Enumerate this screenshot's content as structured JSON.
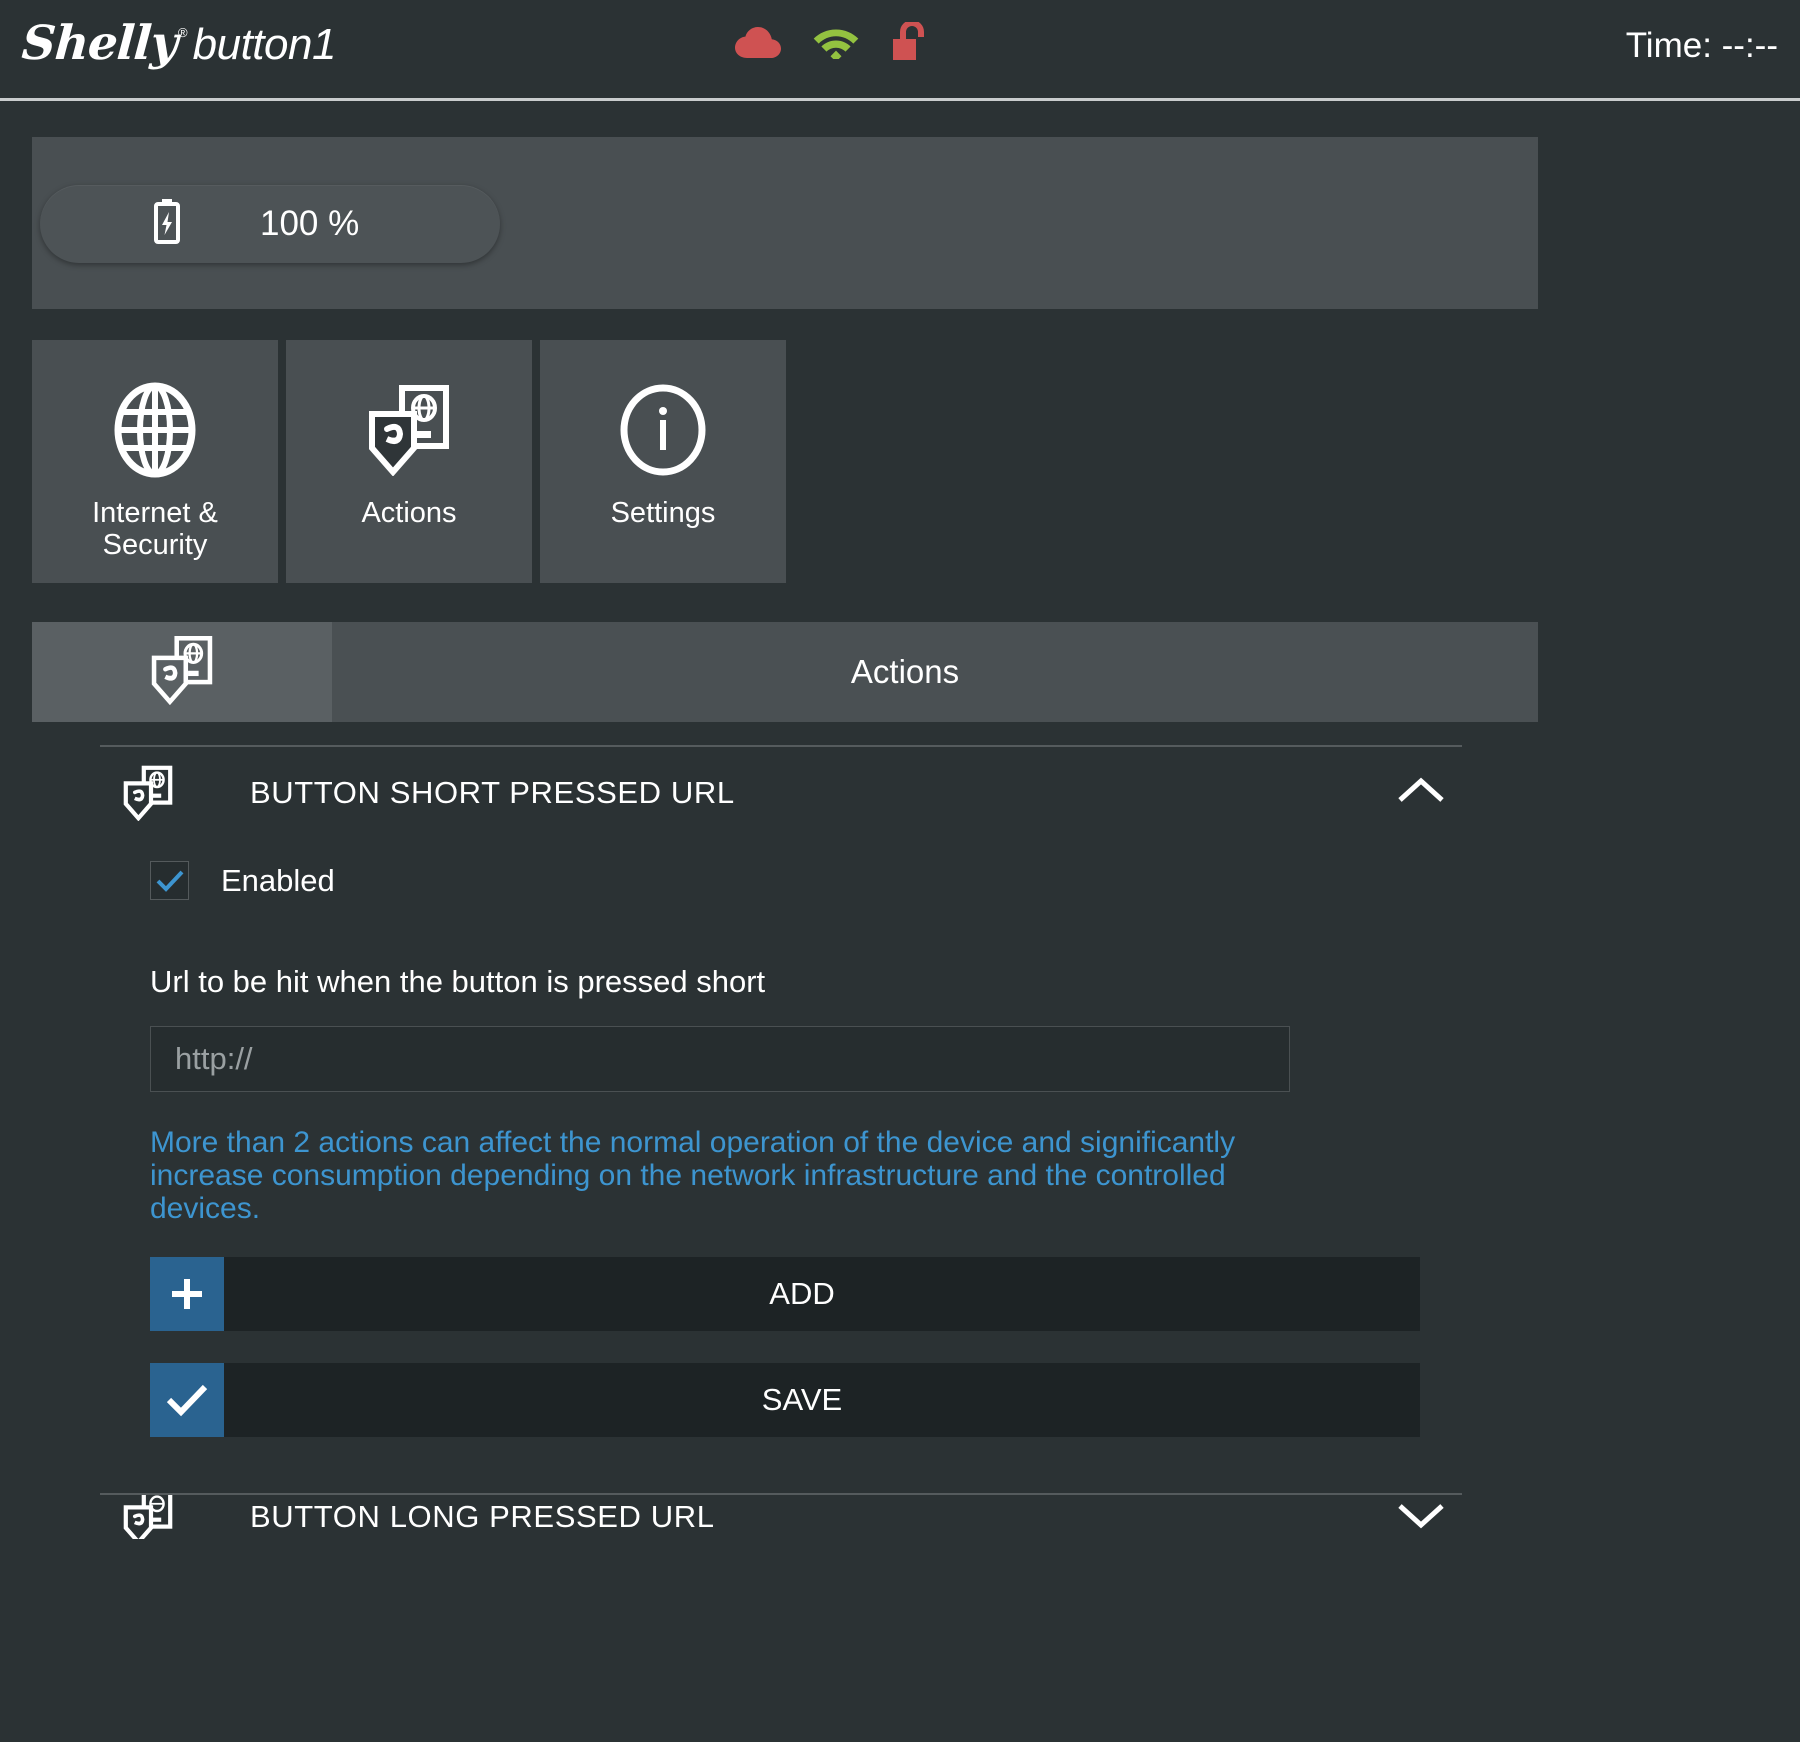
{
  "header": {
    "brand": "Shelly",
    "trademark": "®",
    "model": "button1",
    "time_label": "Time: --:--",
    "icons": [
      {
        "name": "cloud-icon",
        "color": "#cf5252"
      },
      {
        "name": "wifi-icon",
        "color": "#93c240"
      },
      {
        "name": "lock-open-icon",
        "color": "#cf5252"
      }
    ]
  },
  "battery": {
    "icon": "battery-charging-icon",
    "value": "100 %"
  },
  "tiles": [
    {
      "icon": "globe-icon",
      "label": "Internet &\nSecurity",
      "label_line1": "Internet &",
      "label_line2": "Security"
    },
    {
      "icon": "actions-icon",
      "label": "Actions",
      "label_line1": "Actions",
      "label_line2": ""
    },
    {
      "icon": "info-icon",
      "label": "Settings",
      "label_line1": "Settings",
      "label_line2": ""
    }
  ],
  "section_bar": {
    "icon": "actions-icon",
    "title": "Actions"
  },
  "sections": [
    {
      "icon": "actions-icon",
      "title": "BUTTON SHORT PRESSED URL",
      "chevron": "chevron-up-icon",
      "expanded": true,
      "checkbox": {
        "label": "Enabled",
        "checked": true
      },
      "field_caption": "Url to be hit when the button is pressed short",
      "url_value": "",
      "url_placeholder": "http://",
      "hint": "More than 2 actions can affect the normal operation of the device and significantly increase consumption depending on the network infrastructure and the controlled devices.",
      "buttons": [
        {
          "icon": "plus-icon",
          "label": "ADD"
        },
        {
          "icon": "check-icon",
          "label": "SAVE"
        }
      ]
    },
    {
      "icon": "actions-icon",
      "title": "BUTTON LONG PRESSED URL",
      "chevron": "chevron-down-icon",
      "expanded": false
    }
  ],
  "colors": {
    "page_bg": "#2b3234",
    "panel_bg": "#494f52",
    "accent_blue": "#2a6390",
    "hint_blue": "#3d95d0",
    "check_blue": "#3d95d0",
    "status_red": "#cf5252",
    "status_green": "#93c240"
  }
}
